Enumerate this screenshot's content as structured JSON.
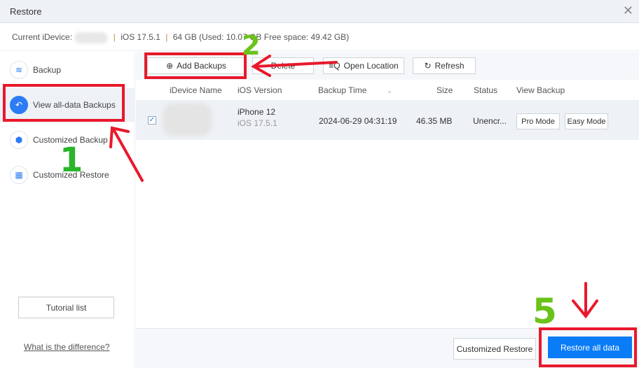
{
  "window": {
    "title": "Restore",
    "close": "✕"
  },
  "device_info": {
    "label": "Current iDevice:",
    "ios": "iOS 17.5.1",
    "storage": "64 GB (Used: 10.07 GB Free space: 49.42 GB)",
    "separator": "|"
  },
  "sidebar": {
    "items": [
      {
        "label": "Backup",
        "icon": "layers-icon",
        "glyph": "≋"
      },
      {
        "label": "View all-data Backups",
        "icon": "undo-arrow-icon",
        "glyph": "↶"
      },
      {
        "label": "Customized Backup",
        "icon": "cube-icon",
        "glyph": "⬢"
      },
      {
        "label": "Customized Restore",
        "icon": "grid-icon",
        "glyph": "▦"
      }
    ],
    "tutorial": "Tutorial list",
    "difference_link": "What is the difference?"
  },
  "toolbar": {
    "add": "Add Backups",
    "delete": "Delete",
    "open": "Open Location",
    "refresh": "Refresh"
  },
  "table": {
    "columns": [
      "iDevice Name",
      "iOS Version",
      "Backup Time",
      "Size",
      "Status",
      "View Backup"
    ],
    "rows": [
      {
        "model": "iPhone 12",
        "ios": "iOS 17.5.1",
        "time": "2024-06-29 04:31:19",
        "size": "46.35 MB",
        "status": "Unencr...",
        "pro": "Pro Mode",
        "easy": "Easy Mode",
        "checked": true
      }
    ]
  },
  "footer": {
    "customized_restore": "Customized Restore",
    "restore_all": "Restore all data"
  },
  "annotations": {
    "step1": "1",
    "step2": "2",
    "step5": "5",
    "red": "#e8192c",
    "green": "#6ac21a"
  }
}
